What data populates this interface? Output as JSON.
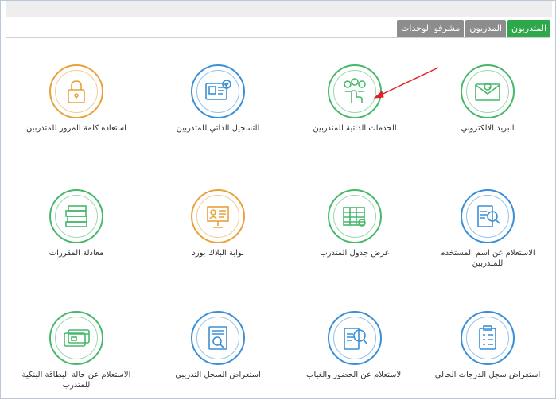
{
  "tabs": [
    {
      "label": "المتدربون",
      "active": true
    },
    {
      "label": "المدربون",
      "active": false
    },
    {
      "label": "مشرفو الوحدات",
      "active": false
    }
  ],
  "tiles": [
    {
      "label": "البريد الالكتروني",
      "icon": "email-icon",
      "color": "#47b86b"
    },
    {
      "label": "الخدمات الذاتية للمتدربين",
      "icon": "self-service-icon",
      "color": "#47b86b"
    },
    {
      "label": "التسجيل الذاتي للمتدربين",
      "icon": "id-card-icon",
      "color": "#3a8fd6"
    },
    {
      "label": "استعادة كلمة المرور للمتدربين",
      "icon": "lock-icon",
      "color": "#e8a23c"
    },
    {
      "label": "الاستعلام عن اسم المستخدم للمتدربين",
      "icon": "search-document-icon",
      "color": "#3a8fd6"
    },
    {
      "label": "عرض جدول المتدرب",
      "icon": "schedule-table-icon",
      "color": "#47b86b"
    },
    {
      "label": "بوابة البلاك بورد",
      "icon": "blackboard-icon",
      "color": "#e8a23c"
    },
    {
      "label": "معادلة المقررات",
      "icon": "books-icon",
      "color": "#47b86b"
    },
    {
      "label": "استعراض سجل الدرجات الحالي",
      "icon": "clipboard-icon",
      "color": "#3a8fd6"
    },
    {
      "label": "الاستعلام عن الحضور والغياب",
      "icon": "attendance-search-icon",
      "color": "#3a8fd6"
    },
    {
      "label": "استعراض السجل التدريبي",
      "icon": "training-record-icon",
      "color": "#3a8fd6"
    },
    {
      "label": "الاستعلام عن حالة البطاقة البنكية للمتدرب",
      "icon": "bank-card-icon",
      "color": "#47b86b"
    }
  ]
}
